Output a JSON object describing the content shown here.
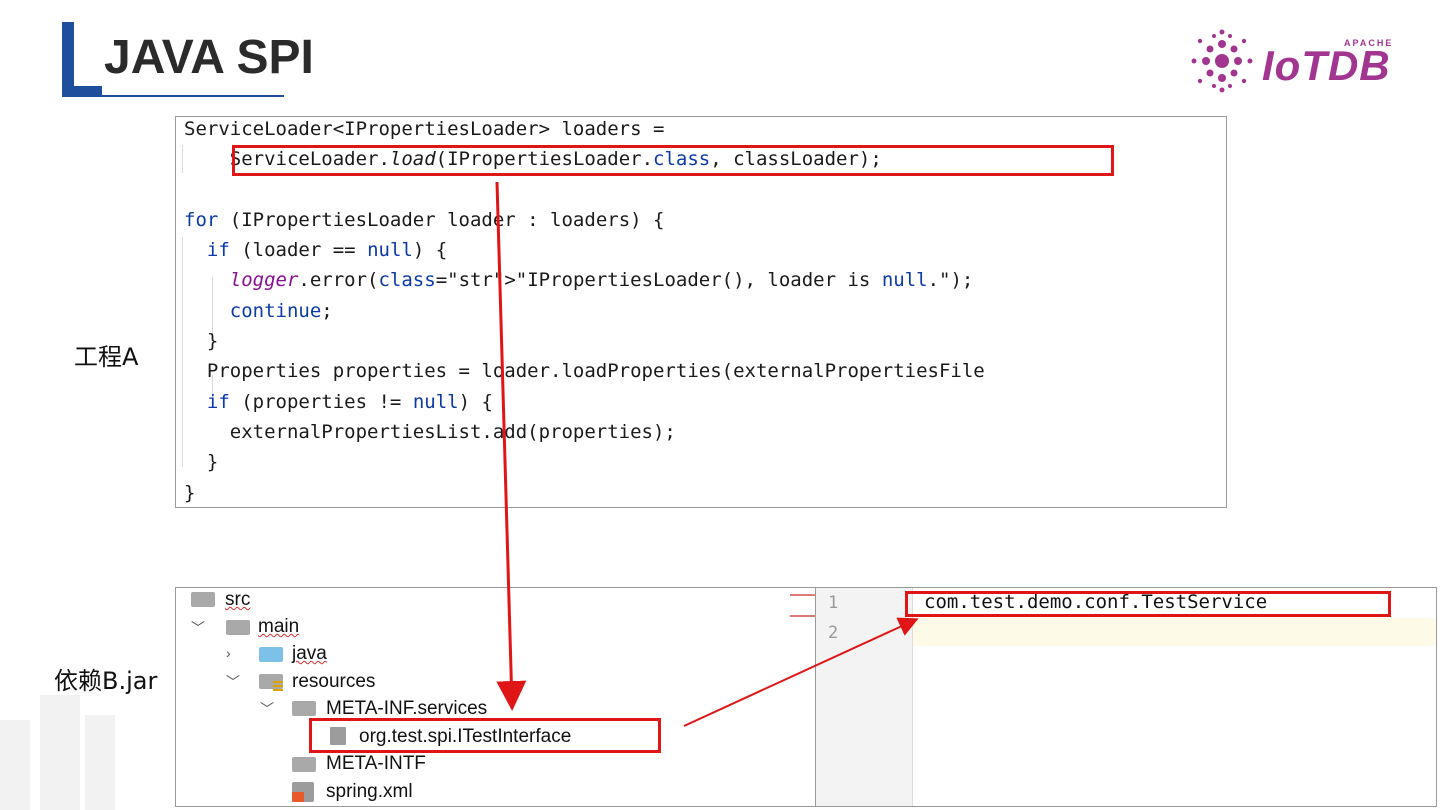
{
  "slide": {
    "title": "JAVA SPI",
    "logo": {
      "small_text": "APACHE",
      "main_text": "IoTDB"
    },
    "label_a": "工程A",
    "label_b": "依赖B.jar"
  },
  "code": {
    "lines": [
      "ServiceLoader<IPropertiesLoader> loaders =",
      "    ServiceLoader.load(IPropertiesLoader.class, classLoader);",
      "",
      "for (IPropertiesLoader loader : loaders) {",
      "  if (loader == null) {",
      "    logger.error(\"IPropertiesLoader(), loader is null.\");",
      "    continue;",
      "  }",
      "  Properties properties = loader.loadProperties(externalPropertiesFile",
      "  if (properties != null) {",
      "    externalPropertiesList.add(properties);",
      "  }",
      "}"
    ]
  },
  "tree": {
    "items": [
      {
        "label": "src"
      },
      {
        "label": "main"
      },
      {
        "label": "java"
      },
      {
        "label": "resources"
      },
      {
        "label": "META-INF.services"
      },
      {
        "label": "org.test.spi.ITestInterface"
      },
      {
        "label": "META-INTF"
      },
      {
        "label": "spring.xml"
      }
    ]
  },
  "editor": {
    "line_numbers": [
      "1",
      "2"
    ],
    "content": "com.test.demo.conf.TestService"
  },
  "colors": {
    "accent": "#1f4e9c",
    "highlight": "#e01515",
    "logo": "#a2358f",
    "keyword": "#0b3aa8",
    "string": "#1a8a1a"
  }
}
